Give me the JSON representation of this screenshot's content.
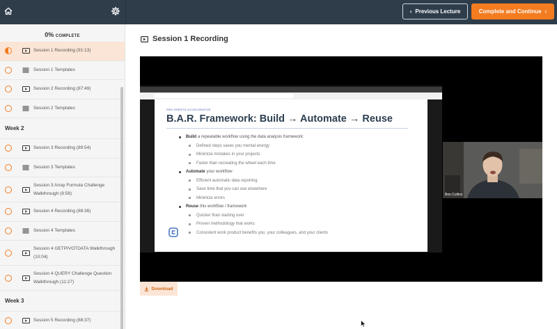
{
  "header": {
    "prev_label": "Previous Lecture",
    "next_label": "Complete and Continue"
  },
  "progress": {
    "percent": "0%",
    "label": "COMPLETE",
    "value": 0
  },
  "sections": [
    {
      "title": "",
      "lectures": [
        {
          "label": "Session 1 Recording (91:13)",
          "type": "video",
          "active": true
        },
        {
          "label": "Session 1 Templates",
          "type": "text",
          "active": false
        },
        {
          "label": "Session 2 Recording (87:49)",
          "type": "video",
          "active": false
        },
        {
          "label": "Session 2 Templates",
          "type": "text",
          "active": false
        }
      ]
    },
    {
      "title": "Week 2",
      "lectures": [
        {
          "label": "Session 3 Recording (89:54)",
          "type": "video",
          "active": false
        },
        {
          "label": "Session 3 Templates",
          "type": "text",
          "active": false
        },
        {
          "label": "Session 3 Array Formula Challenge Walkthrough (8:58)",
          "type": "video",
          "active": false
        },
        {
          "label": "Session 4 Recording (88:36)",
          "type": "video",
          "active": false
        },
        {
          "label": "Session 4 Templates",
          "type": "text",
          "active": false
        },
        {
          "label": "Session 4 GETPIVOTDATA Walkthrough (10:04)",
          "type": "video",
          "active": false
        },
        {
          "label": "Session 4 QUERY Challenge Question Walkthrough (11:27)",
          "type": "video",
          "active": false
        }
      ]
    },
    {
      "title": "Week 3",
      "lectures": [
        {
          "label": "Session 5 Recording (88:37)",
          "type": "video",
          "active": false
        }
      ]
    }
  ],
  "main": {
    "title": "Session 1 Recording",
    "download_label": "Download"
  },
  "slide": {
    "kicker": "PRO SHEETS ACCELERATOR",
    "title": "B.A.R. Framework: Build → Automate → Reuse",
    "bullets": [
      {
        "bold": "Build",
        "rest": "a repeatable workflow using the data analysis framework:",
        "subs": [
          "Defined steps saves you mental energy",
          "Minimize mistakes in your projects",
          "Faster than recreating the wheel each time"
        ]
      },
      {
        "bold": "Automate",
        "rest": "your workflow:",
        "subs": [
          "Efficient automatic data reporting",
          "Save time that you can use elsewhere",
          "Minimize errors"
        ]
      },
      {
        "bold": "Reuse",
        "rest": "this workflow / framework",
        "subs": [
          "Quicker than starting over",
          "Proven methodology that works",
          "Consistent work product benefits you, your colleagues, and your clients"
        ]
      }
    ]
  },
  "webcam": {
    "name": "Ben Collins"
  },
  "colors": {
    "accent": "#f47c20",
    "topbar": "#2f3d4b",
    "active_row": "#fbe5d6"
  },
  "icons": {
    "home": "home-icon",
    "settings": "gear-icon",
    "video": "video-play-icon",
    "text": "text-lines-icon"
  }
}
